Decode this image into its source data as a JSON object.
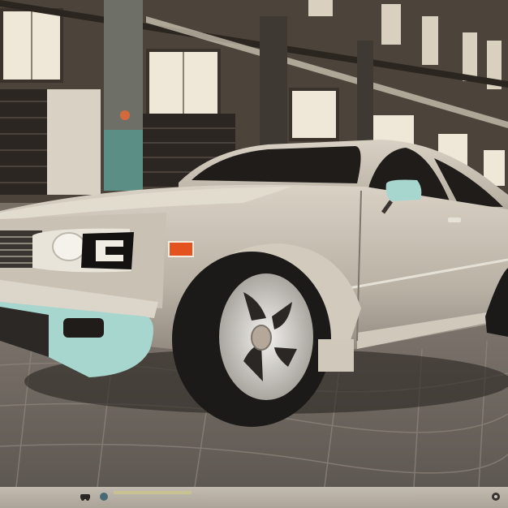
{
  "image": {
    "subject": "car",
    "colors": {
      "body": "#b9b1a4",
      "body_shadow": "#8e877c",
      "accent": "#a7d6cf",
      "building": "#7a6f62",
      "window": "#efe7d7",
      "road": "#6f6862",
      "tire": "#1c1a18",
      "rim": "#d8d6d0"
    }
  },
  "bottom_strip": {
    "icons": [
      "car-icon",
      "circle-icon",
      "settings-icon"
    ]
  }
}
